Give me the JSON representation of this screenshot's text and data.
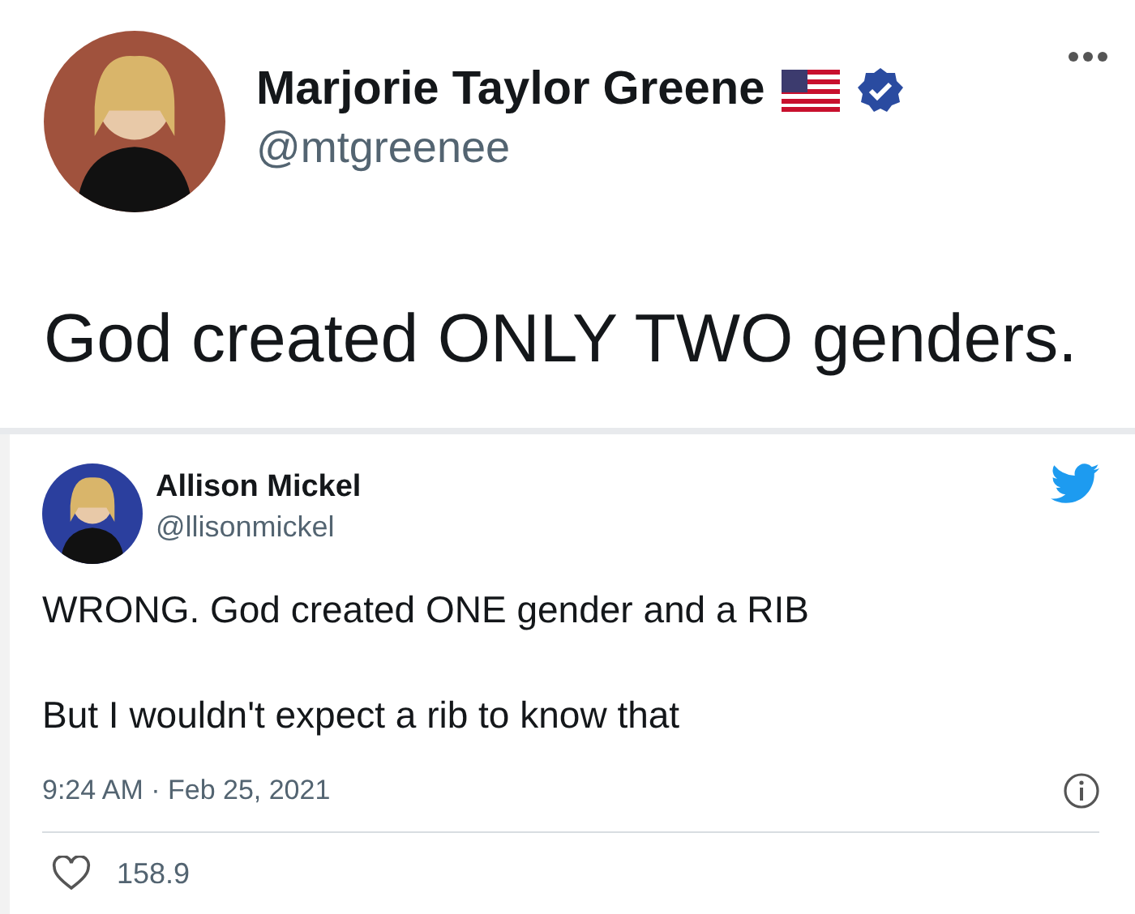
{
  "main_tweet": {
    "name": "Marjorie Taylor Greene",
    "verified": true,
    "handle": "@mtgreenee",
    "text": "God created ONLY TWO genders."
  },
  "reply_tweet": {
    "name": "Allison Mickel",
    "handle": "@llisonmickel",
    "paragraphs": [
      "WRONG. God created ONE gender and a RIB",
      "But I wouldn't expect a rib to know that"
    ],
    "timestamp": "9:24 AM · Feb 25, 2021",
    "like_count": "158.9"
  }
}
